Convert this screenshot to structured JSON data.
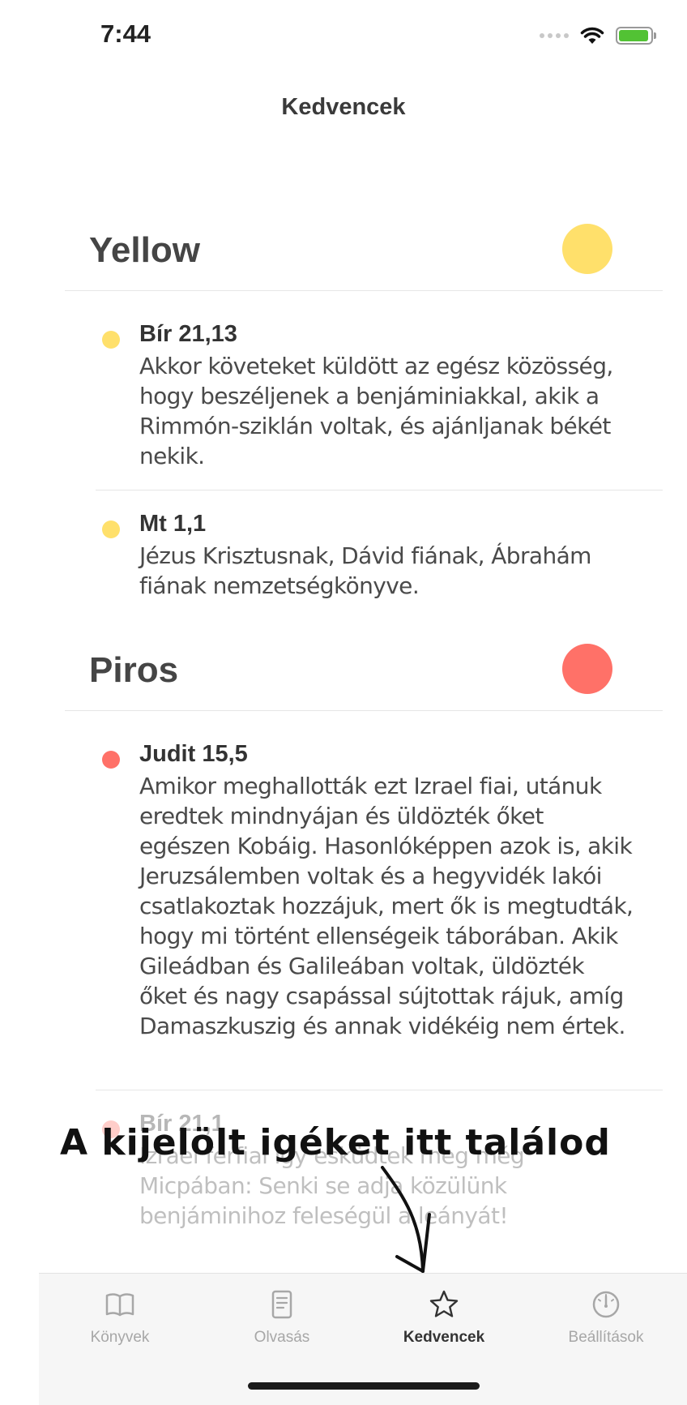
{
  "status_bar": {
    "time": "7:44"
  },
  "nav": {
    "title": "Kedvencek"
  },
  "sections": [
    {
      "title": "Yellow",
      "color": "#ffe06b",
      "verses": [
        {
          "ref": "Bír 21,13",
          "text": "Akkor követeket küldött az egész közösség, hogy beszéljenek a benjáminiakkal, akik a Rimmón-sziklán voltak, és ajánljanak békét nekik."
        },
        {
          "ref": "Mt 1,1",
          "text": "Jézus Krisztusnak, Dávid fiának, Ábrahám fiának nemzetségkönyve."
        }
      ]
    },
    {
      "title": "Piros",
      "color": "#ff7168",
      "verses": [
        {
          "ref": "Judit 15,5",
          "text": "Amikor meghallották ezt Izrael fiai, utánuk eredtek mindnyájan és üldözték őket egészen Kobáig. Hasonlóképpen azok is, akik Jeruzsálemben voltak és a hegyvidék lakói csatlakoztak hozzájuk, mert ők is megtudták, hogy mi történt ellenségeik táborában. Akik Gileádban és Galileában voltak, üldözték őket és nagy csapással sújtottak rájuk, amíg Damaszkuszig és annak vidékéig nem értek."
        },
        {
          "ref": "Bír 21,1",
          "text": "Izrael férfiai így esküdtek meg még Micpában: Senki se adja közülünk benjáminihoz feleségül a leányát!"
        }
      ]
    }
  ],
  "annotation": {
    "text": "A kijelölt igéket itt találod"
  },
  "tabbar": {
    "tabs": [
      {
        "label": "Könyvek",
        "icon": "book-icon",
        "active": false
      },
      {
        "label": "Olvasás",
        "icon": "document-icon",
        "active": false
      },
      {
        "label": "Kedvencek",
        "icon": "star-icon",
        "active": true
      },
      {
        "label": "Beállítások",
        "icon": "gauge-icon",
        "active": false
      }
    ]
  }
}
